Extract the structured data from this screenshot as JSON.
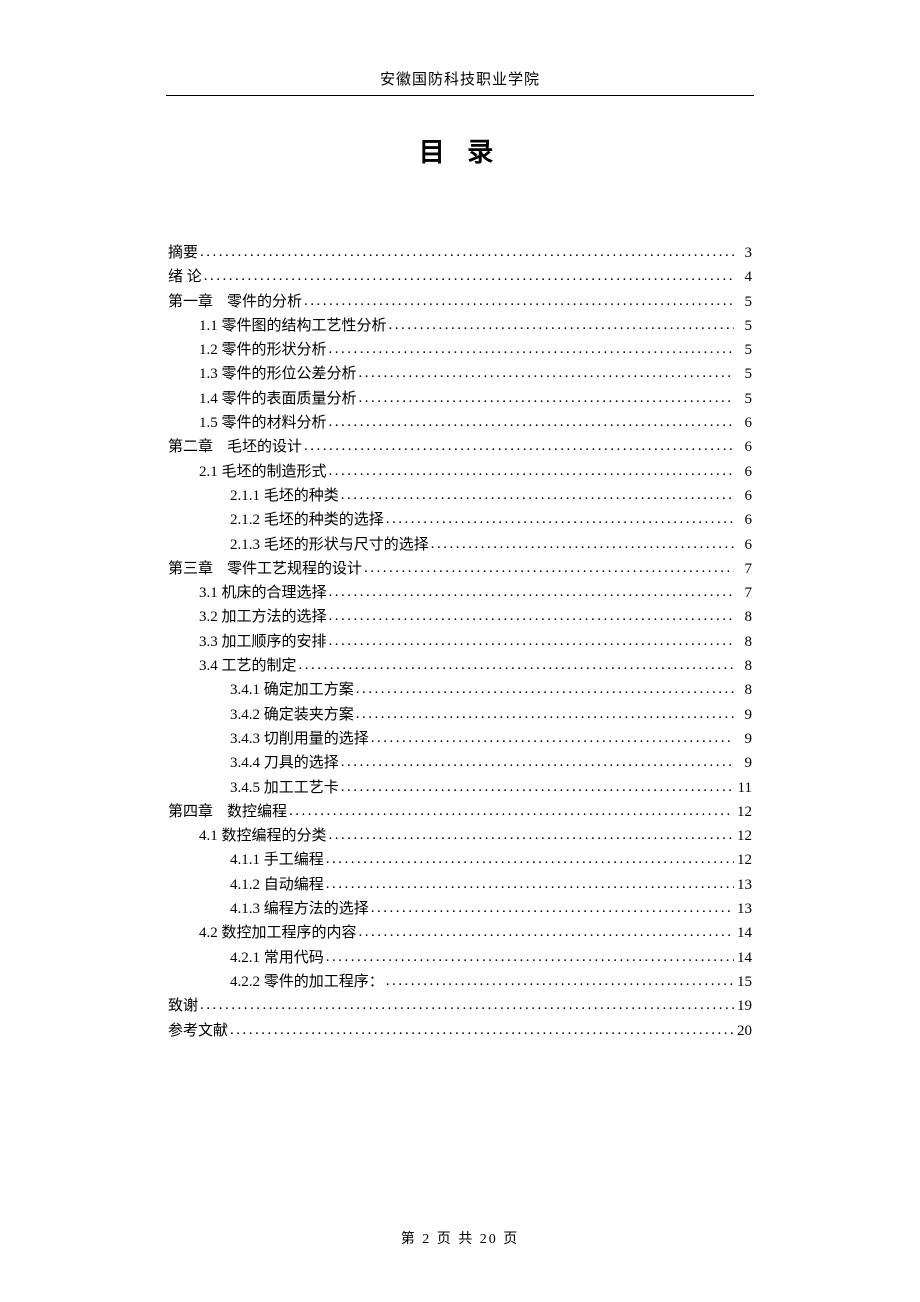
{
  "header": "安徽国防科技职业学院",
  "title": "目 录",
  "footer": "第 2 页 共 20 页",
  "toc": [
    {
      "indent": 0,
      "label": "摘要",
      "page": "3"
    },
    {
      "indent": 0,
      "label": "绪 论",
      "page": "4"
    },
    {
      "indent": 0,
      "label": "第一章",
      "title": "零件的分析",
      "page": "5"
    },
    {
      "indent": 1,
      "label": "1.1 零件图的结构工艺性分析",
      "page": "5"
    },
    {
      "indent": 1,
      "label": "1.2 零件的形状分析",
      "page": "5"
    },
    {
      "indent": 1,
      "label": "1.3 零件的形位公差分析",
      "page": "5"
    },
    {
      "indent": 1,
      "label": "1.4 零件的表面质量分析",
      "page": "5"
    },
    {
      "indent": 1,
      "label": "1.5 零件的材料分析",
      "page": "6"
    },
    {
      "indent": 0,
      "label": "第二章",
      "title": "毛坯的设计",
      "page": "6"
    },
    {
      "indent": 1,
      "label": "2.1 毛坯的制造形式",
      "page": "6"
    },
    {
      "indent": 2,
      "label": "2.1.1 毛坯的种类",
      "page": "6"
    },
    {
      "indent": 2,
      "label": "2.1.2 毛坯的种类的选择",
      "page": "6"
    },
    {
      "indent": 2,
      "label": "2.1.3 毛坯的形状与尺寸的选择",
      "page": "6"
    },
    {
      "indent": 0,
      "label": "第三章",
      "title": "零件工艺规程的设计",
      "page": "7"
    },
    {
      "indent": 1,
      "label": "3.1 机床的合理选择",
      "page": "7"
    },
    {
      "indent": 1,
      "label": "3.2 加工方法的选择",
      "page": "8"
    },
    {
      "indent": 1,
      "label": "3.3 加工顺序的安排",
      "page": "8"
    },
    {
      "indent": 1,
      "label": "3.4 工艺的制定",
      "page": "8"
    },
    {
      "indent": 2,
      "label": "3.4.1 确定加工方案",
      "page": "8"
    },
    {
      "indent": 2,
      "label": "3.4.2 确定装夹方案",
      "page": "9"
    },
    {
      "indent": 2,
      "label": "3.4.3 切削用量的选择",
      "page": "9"
    },
    {
      "indent": 2,
      "label": "3.4.4 刀具的选择",
      "page": "9"
    },
    {
      "indent": 2,
      "label": "3.4.5 加工工艺卡",
      "page": "11"
    },
    {
      "indent": 0,
      "label": "第四章",
      "title": "数控编程",
      "page": "12"
    },
    {
      "indent": 1,
      "label": "4.1 数控编程的分类",
      "page": "12"
    },
    {
      "indent": 2,
      "label": "4.1.1 手工编程",
      "page": "12"
    },
    {
      "indent": 2,
      "label": "4.1.2 自动编程",
      "page": "13"
    },
    {
      "indent": 2,
      "label": "4.1.3 编程方法的选择",
      "page": "13"
    },
    {
      "indent": 1,
      "label": "4.2 数控加工程序的内容",
      "page": "14"
    },
    {
      "indent": 2,
      "label": "4.2.1 常用代码",
      "page": "14"
    },
    {
      "indent": 2,
      "label": "4.2.2 零件的加工程序：",
      "page": "15"
    },
    {
      "indent": 0,
      "label": "致谢",
      "page": "19"
    },
    {
      "indent": 0,
      "label": "参考文献",
      "page": "20"
    }
  ]
}
